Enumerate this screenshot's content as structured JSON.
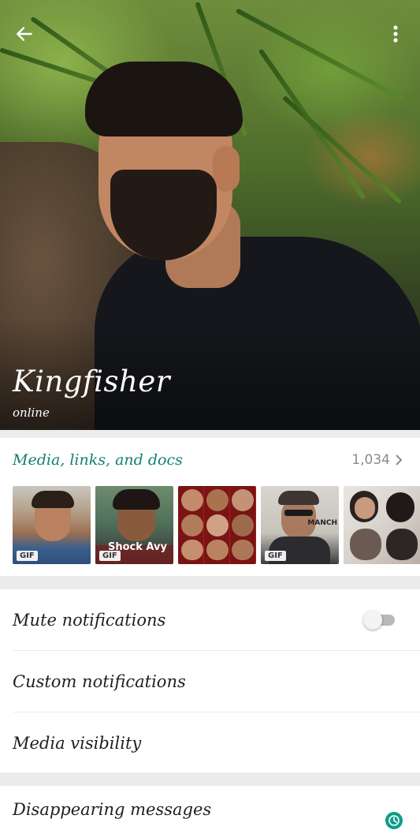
{
  "header": {
    "back_icon": "arrow-left-icon",
    "menu_icon": "more-vertical-icon",
    "contact_name": "Kingfisher",
    "status": "online"
  },
  "media": {
    "title": "Media, links, and docs",
    "count": "1,034",
    "chevron_icon": "chevron-right-icon",
    "thumbnails": [
      {
        "badge": "GIF"
      },
      {
        "badge": "GIF",
        "caption": "Shock Avy"
      },
      {
        "badge": ""
      },
      {
        "badge": "GIF",
        "caption": "MANCH"
      },
      {
        "badge": ""
      }
    ]
  },
  "settings": {
    "mute_label": "Mute notifications",
    "mute_enabled": false,
    "custom_label": "Custom notifications",
    "visibility_label": "Media visibility"
  },
  "disappearing": {
    "label": "Disappearing messages",
    "icon": "timer-icon",
    "accent": "#0f9d87"
  },
  "colors": {
    "accent": "#0f7f73",
    "background": "#ececec"
  }
}
